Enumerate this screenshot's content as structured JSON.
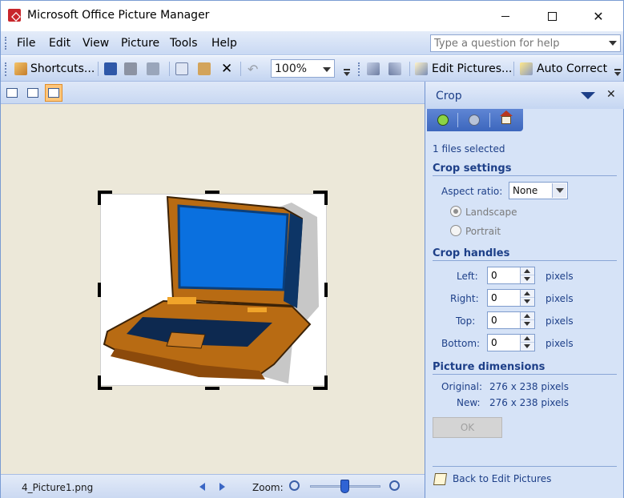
{
  "window": {
    "title": "Microsoft Office Picture Manager"
  },
  "menu": [
    "File",
    "Edit",
    "View",
    "Picture",
    "Tools",
    "Help"
  ],
  "help": {
    "placeholder": "Type a question for help"
  },
  "toolbar": {
    "shortcuts_label": "Shortcuts...",
    "zoom_value": "100%",
    "edit_pictures_label": "Edit Pictures...",
    "auto_correct_label": "Auto Correct"
  },
  "status": {
    "filename": "4_Picture1.png",
    "zoom_label": "Zoom:"
  },
  "pane": {
    "title": "Crop",
    "files_selected": "1 files selected",
    "crop_settings": "Crop settings",
    "aspect_label": "Aspect ratio:",
    "aspect_value": "None",
    "landscape": "Landscape",
    "portrait": "Portrait",
    "crop_handles": "Crop handles",
    "handles": [
      {
        "label": "Left:",
        "value": "0",
        "unit": "pixels"
      },
      {
        "label": "Right:",
        "value": "0",
        "unit": "pixels"
      },
      {
        "label": "Top:",
        "value": "0",
        "unit": "pixels"
      },
      {
        "label": "Bottom:",
        "value": "0",
        "unit": "pixels"
      }
    ],
    "dimensions_title": "Picture dimensions",
    "original_label": "Original:",
    "original_value": "276 x 238 pixels",
    "new_label": "New:",
    "new_value": "276 x 238 pixels",
    "ok_label": "OK",
    "back_link": "Back to Edit Pictures"
  }
}
